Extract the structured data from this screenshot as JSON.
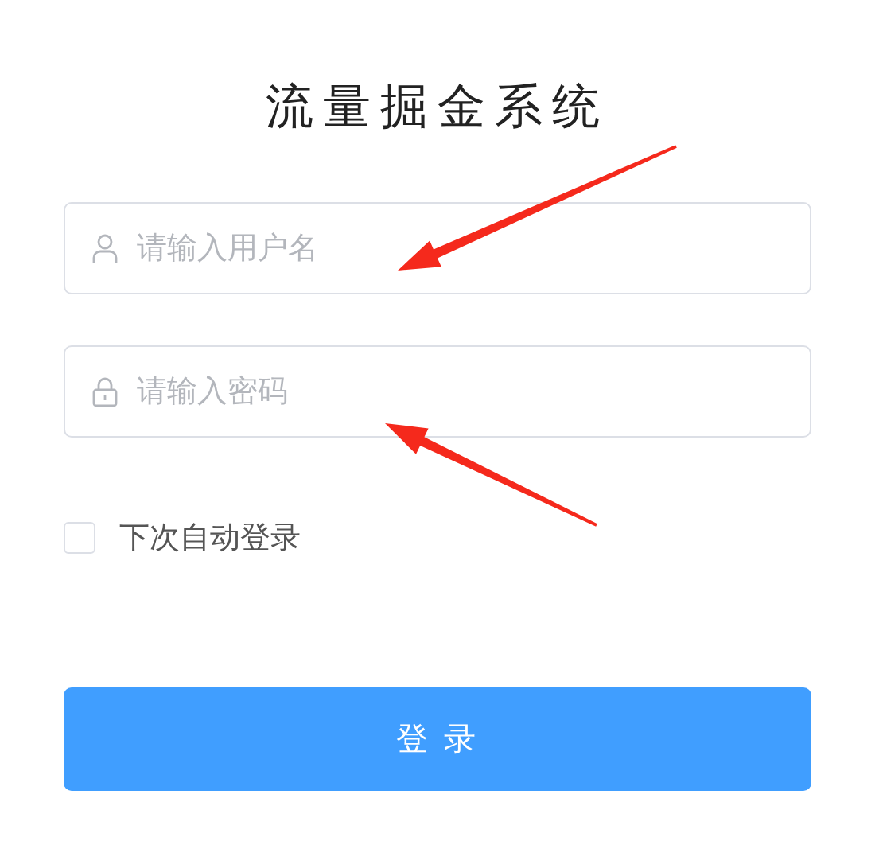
{
  "title": "流量掘金系统",
  "fields": [
    {
      "kind": "user",
      "placeholder": "请输入用户名"
    },
    {
      "kind": "password",
      "placeholder": "请输入密码"
    }
  ],
  "remember": {
    "label": "下次自动登录",
    "checked": false
  },
  "login_button": "登 录",
  "annotations": [
    {
      "kind": "arrow"
    },
    {
      "kind": "arrow"
    }
  ]
}
